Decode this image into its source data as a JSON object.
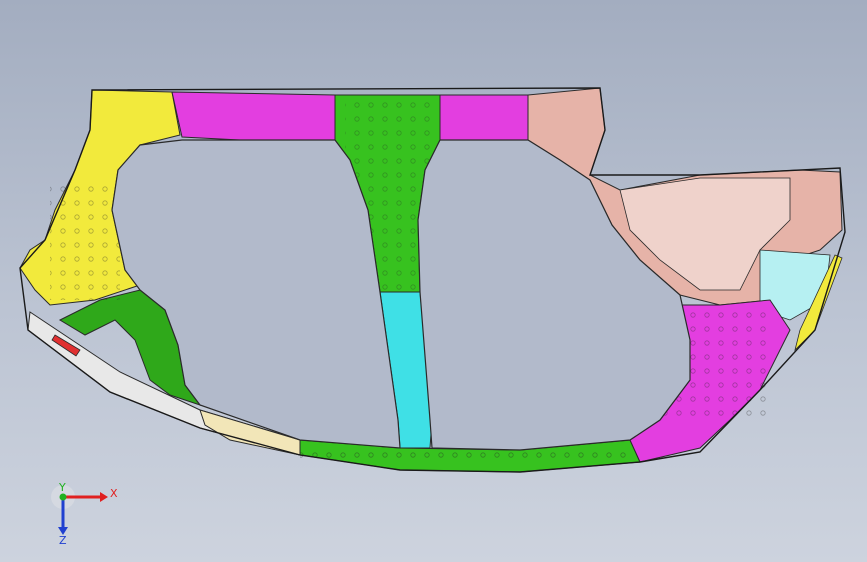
{
  "viewport": {
    "background_top": "#a3adc0",
    "background_bottom": "#cdd3de"
  },
  "model": {
    "description_icon": "car-body-side-frame",
    "colors": {
      "outline": "#2a2a2a",
      "yellow": "#f2ea3c",
      "magenta": "#e33ee0",
      "green": "#37c21f",
      "dark_green": "#2fa81a",
      "cyan": "#3fe0e6",
      "salmon": "#e6b3a8",
      "light_grey": "#e8e8e8",
      "cream": "#f2e6b8",
      "red": "#e03030"
    }
  },
  "triad": {
    "x_label": "X",
    "y_label": "Y",
    "z_label": "Z",
    "x_color": "#e02020",
    "y_color": "#20b020",
    "z_color": "#2040d0"
  }
}
